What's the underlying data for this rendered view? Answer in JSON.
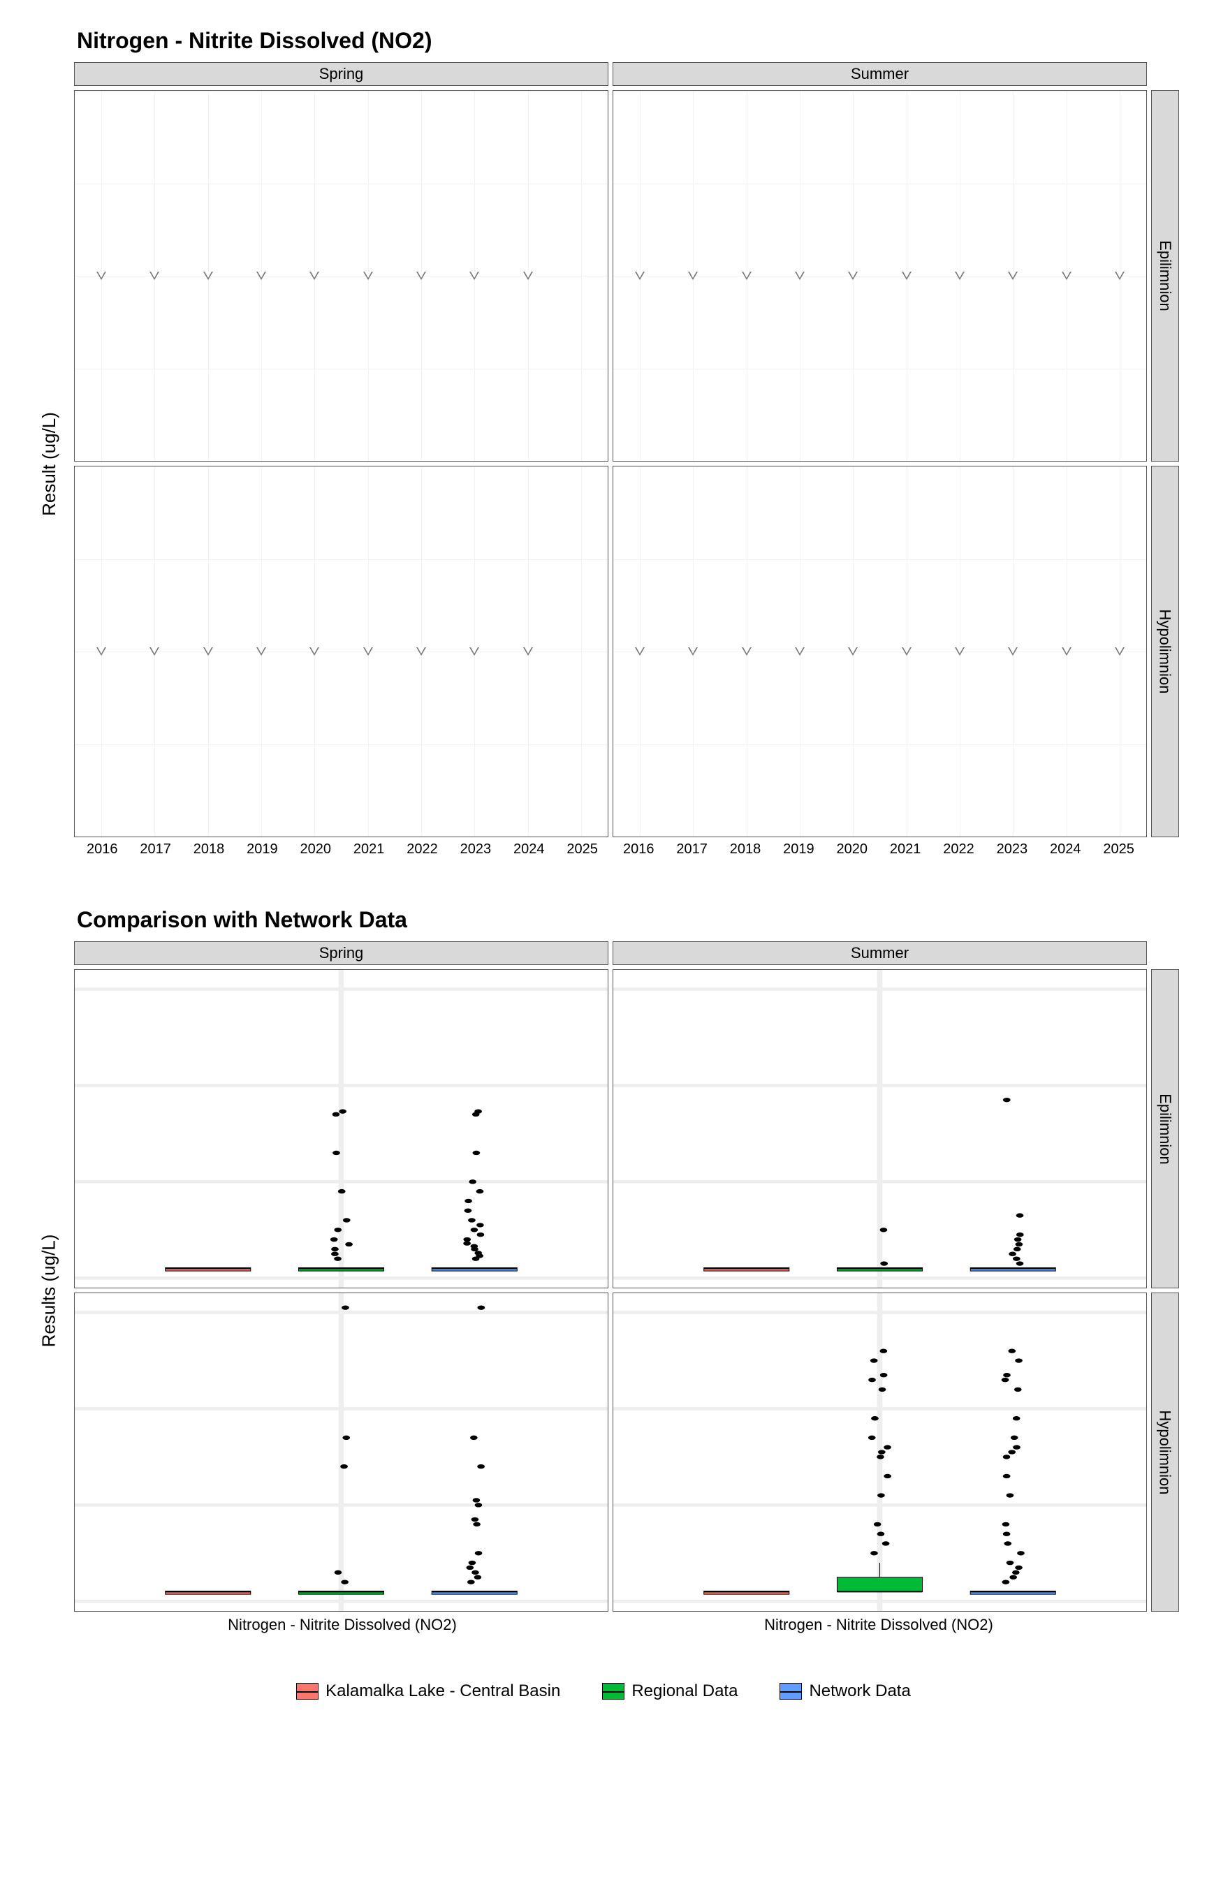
{
  "chart_data": [
    {
      "id": "top",
      "type": "scatter",
      "title": "Nitrogen - Nitrite Dissolved (NO2)",
      "ylabel": "Result (ug/L)",
      "ylim": [
        0.95,
        1.05
      ],
      "yticks": [
        0.95,
        0.975,
        1.0,
        1.025,
        1.05
      ],
      "xlim": [
        2015.5,
        2025.5
      ],
      "xticks": [
        2016,
        2017,
        2018,
        2019,
        2020,
        2021,
        2022,
        2023,
        2024,
        2025
      ],
      "facets_cols": [
        "Spring",
        "Summer"
      ],
      "facets_rows": [
        "Epilimnion",
        "Hypolimnion"
      ],
      "point_shape": "open-triangle-down",
      "series": [
        {
          "col": "Spring",
          "row": "Epilimnion",
          "x": [
            2016,
            2017,
            2018,
            2019,
            2020,
            2021,
            2022,
            2023,
            2024
          ],
          "y": [
            1,
            1,
            1,
            1,
            1,
            1,
            1,
            1,
            1
          ]
        },
        {
          "col": "Summer",
          "row": "Epilimnion",
          "x": [
            2016,
            2017,
            2018,
            2019,
            2020,
            2021,
            2022,
            2023,
            2024,
            2025
          ],
          "y": [
            1,
            1,
            1,
            1,
            1,
            1,
            1,
            1,
            1,
            1
          ]
        },
        {
          "col": "Spring",
          "row": "Hypolimnion",
          "x": [
            2016,
            2017,
            2018,
            2019,
            2020,
            2021,
            2022,
            2023,
            2024
          ],
          "y": [
            1,
            1,
            1,
            1,
            1,
            1,
            1,
            1,
            1
          ]
        },
        {
          "col": "Summer",
          "row": "Hypolimnion",
          "x": [
            2016,
            2017,
            2018,
            2019,
            2020,
            2021,
            2022,
            2023,
            2024,
            2025
          ],
          "y": [
            1,
            1,
            1,
            1,
            1,
            1,
            1,
            1,
            1,
            1
          ]
        }
      ]
    },
    {
      "id": "bottom",
      "type": "box",
      "title": "Comparison with Network Data",
      "ylabel": "Results (ug/L)",
      "ylim": [
        -1,
        32
      ],
      "yticks": [
        0,
        10,
        20,
        30
      ],
      "xlabel": "Nitrogen - Nitrite Dissolved (NO2)",
      "facets_cols": [
        "Spring",
        "Summer"
      ],
      "facets_rows": [
        "Epilimnion",
        "Hypolimnion"
      ],
      "groups": [
        "Kalamalka Lake - Central Basin",
        "Regional Data",
        "Network Data"
      ],
      "group_colors": {
        "Kalamalka Lake - Central Basin": "#f8766d",
        "Regional Data": "#00ba38",
        "Network Data": "#619cff"
      },
      "panels": {
        "Spring_Epilimnion": {
          "Kalamalka Lake - Central Basin": {
            "q1": 1,
            "med": 1,
            "q3": 1,
            "low": 1,
            "high": 1,
            "out": []
          },
          "Regional Data": {
            "q1": 1,
            "med": 1,
            "q3": 1,
            "low": 1,
            "high": 1,
            "out": [
              2,
              2.5,
              3,
              3.5,
              4,
              5,
              6,
              9,
              13,
              17,
              17.3
            ]
          },
          "Network Data": {
            "q1": 1,
            "med": 1,
            "q3": 1,
            "low": 1,
            "high": 1,
            "out": [
              2,
              2.3,
              2.6,
              3,
              3.3,
              3.6,
              4,
              4.5,
              5,
              5.5,
              6,
              7,
              8,
              9,
              10,
              13,
              17,
              17.3
            ]
          }
        },
        "Summer_Epilimnion": {
          "Kalamalka Lake - Central Basin": {
            "q1": 1,
            "med": 1,
            "q3": 1,
            "low": 1,
            "high": 1,
            "out": []
          },
          "Regional Data": {
            "q1": 1,
            "med": 1,
            "q3": 1,
            "low": 1,
            "high": 1,
            "out": [
              1.5,
              5
            ]
          },
          "Network Data": {
            "q1": 1,
            "med": 1,
            "q3": 1,
            "low": 1,
            "high": 1,
            "out": [
              1.5,
              2,
              2.5,
              3,
              3.5,
              4,
              4.5,
              6.5,
              18.5
            ]
          }
        },
        "Spring_Hypolimnion": {
          "Kalamalka Lake - Central Basin": {
            "q1": 1,
            "med": 1,
            "q3": 1,
            "low": 1,
            "high": 1,
            "out": []
          },
          "Regional Data": {
            "q1": 1,
            "med": 1,
            "q3": 1,
            "low": 1,
            "high": 1,
            "out": [
              2,
              3,
              14,
              17,
              30.5
            ]
          },
          "Network Data": {
            "q1": 1,
            "med": 1,
            "q3": 1,
            "low": 1,
            "high": 1,
            "out": [
              2,
              2.5,
              3,
              3.5,
              4,
              5,
              8,
              8.5,
              10,
              10.5,
              14,
              17,
              30.5
            ]
          }
        },
        "Summer_Hypolimnion": {
          "Kalamalka Lake - Central Basin": {
            "q1": 1,
            "med": 1,
            "q3": 1,
            "low": 1,
            "high": 1,
            "out": []
          },
          "Regional Data": {
            "q1": 1,
            "med": 1,
            "q3": 2.5,
            "low": 1,
            "high": 4,
            "out": [
              5,
              6,
              7,
              8,
              11,
              13,
              15,
              15.5,
              16,
              17,
              19,
              22,
              23,
              23.5,
              25,
              26
            ]
          },
          "Network Data": {
            "q1": 1,
            "med": 1,
            "q3": 1,
            "low": 1,
            "high": 1,
            "out": [
              2,
              2.5,
              3,
              3.5,
              4,
              5,
              6,
              7,
              8,
              11,
              13,
              15,
              15.5,
              16,
              17,
              19,
              22,
              23,
              23.5,
              25,
              26
            ]
          }
        }
      }
    }
  ],
  "legend": {
    "items": [
      {
        "label": "Kalamalka Lake - Central Basin",
        "cls": "lg-red"
      },
      {
        "label": "Regional Data",
        "cls": "lg-green"
      },
      {
        "label": "Network Data",
        "cls": "lg-blue"
      }
    ]
  }
}
